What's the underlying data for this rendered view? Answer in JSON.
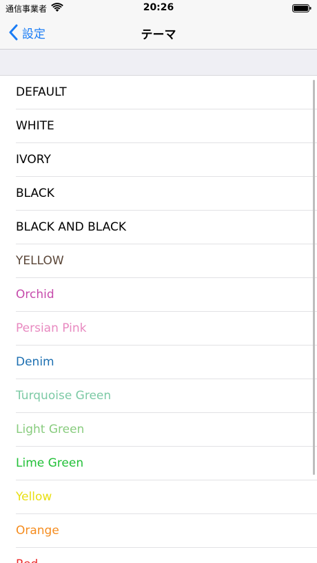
{
  "status_bar": {
    "carrier": "通信事業者",
    "time": "20:26"
  },
  "nav": {
    "back_label": "設定",
    "title": "テーマ"
  },
  "themes": [
    {
      "label": "DEFAULT",
      "color": "#000000"
    },
    {
      "label": "WHITE",
      "color": "#000000"
    },
    {
      "label": "IVORY",
      "color": "#000000"
    },
    {
      "label": "BLACK",
      "color": "#000000"
    },
    {
      "label": "BLACK AND BLACK",
      "color": "#000000"
    },
    {
      "label": "YELLOW",
      "color": "#5a4638"
    },
    {
      "label": "Orchid",
      "color": "#c64bab"
    },
    {
      "label": "Persian Pink",
      "color": "#e889c0"
    },
    {
      "label": "Denim",
      "color": "#1c6fb1"
    },
    {
      "label": "Turquoise Green",
      "color": "#7ccaa5"
    },
    {
      "label": "Light Green",
      "color": "#88cc7e"
    },
    {
      "label": "Lime Green",
      "color": "#22c038"
    },
    {
      "label": "Yellow",
      "color": "#e8df12"
    },
    {
      "label": "Orange",
      "color": "#f58c1e"
    },
    {
      "label": "Red",
      "color": "#ec2b2b"
    }
  ],
  "icons": {
    "wifi": "wifi-icon",
    "battery": "battery-icon",
    "back": "chevron-left-icon"
  },
  "colors": {
    "accent": "#1a7cf5",
    "bar_background": "#f7f7f7",
    "section_background": "#efeff4"
  }
}
